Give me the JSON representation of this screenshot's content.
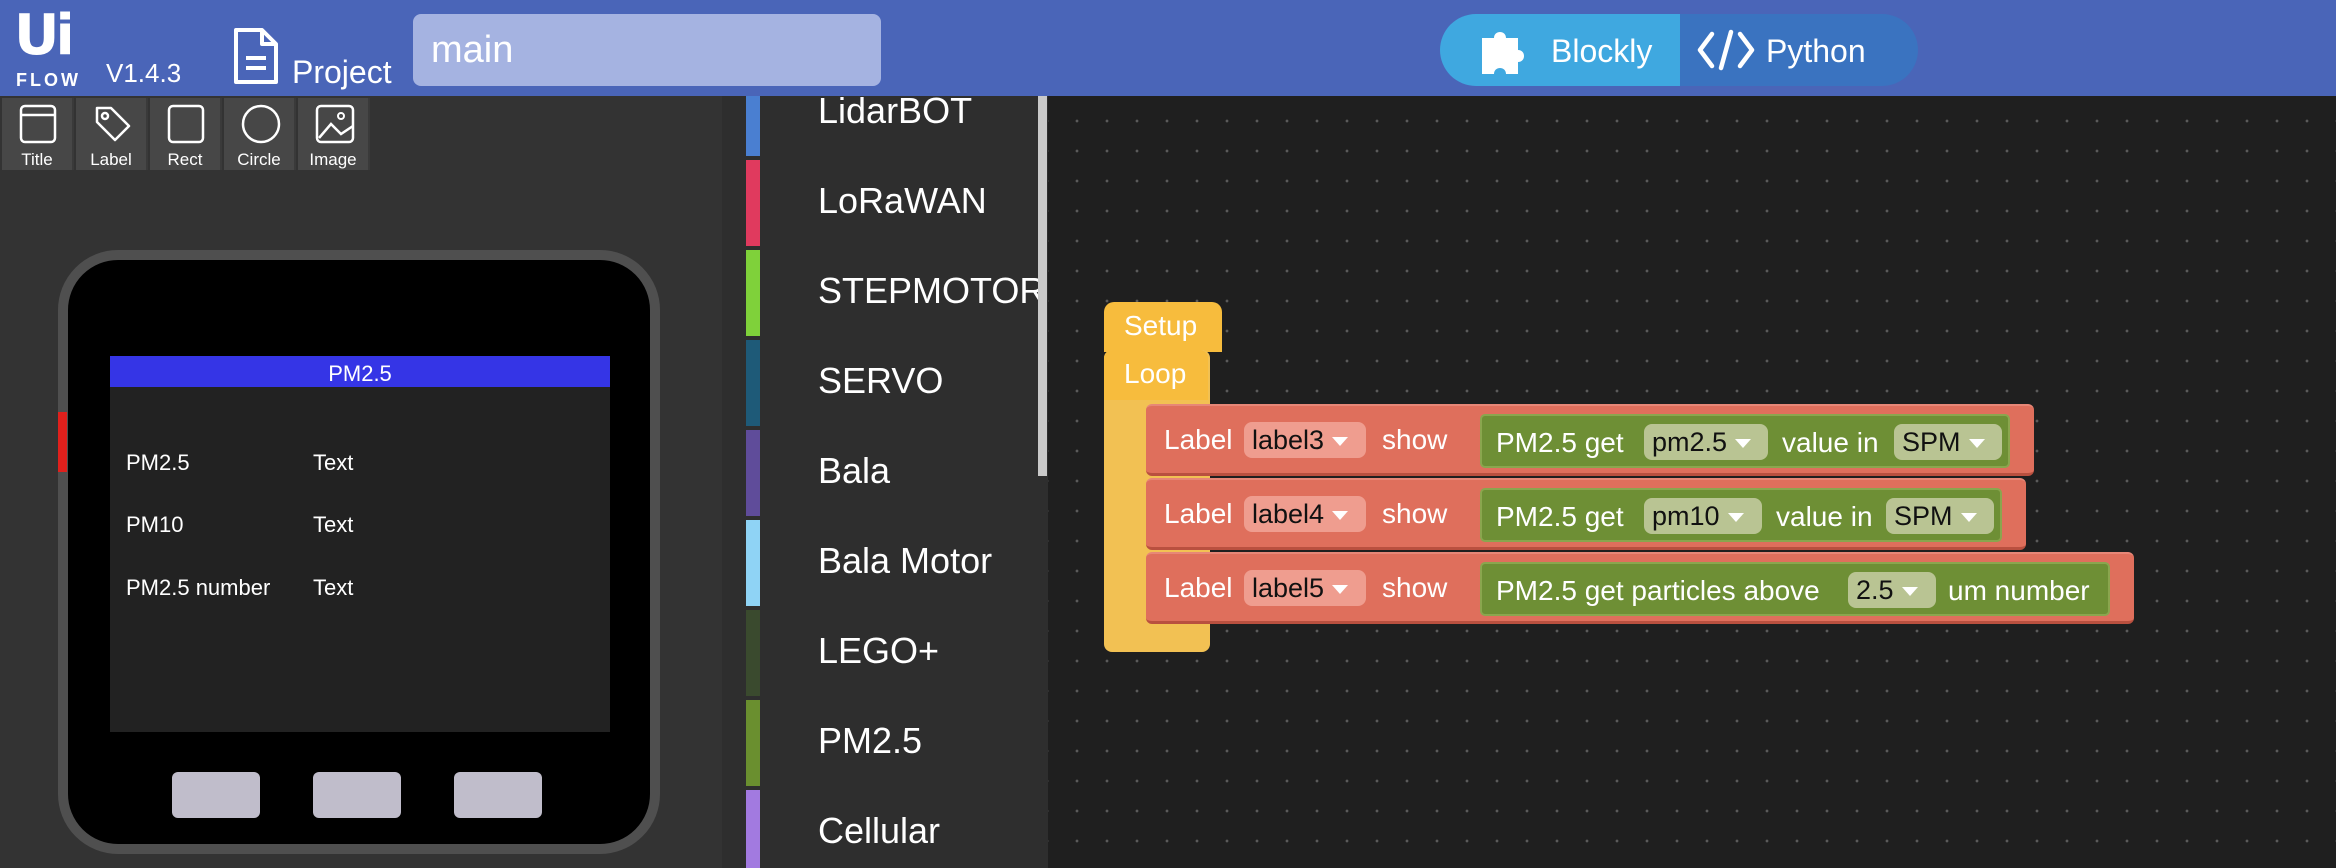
{
  "header": {
    "logo_ui": "Ui",
    "logo_flow": "FLOW",
    "version": "V1.4.3",
    "project_label": "Project",
    "filename": "main",
    "mode_blockly": "Blockly",
    "mode_python": "Python",
    "colors": {
      "bar": "#4a65b8",
      "blockly": "#3fa8e0",
      "python": "#3a73c0"
    }
  },
  "widgets": [
    {
      "label": "Title",
      "icon": "title-icon"
    },
    {
      "label": "Label",
      "icon": "tag-icon"
    },
    {
      "label": "Rect",
      "icon": "rect-icon"
    },
    {
      "label": "Circle",
      "icon": "circle-icon"
    },
    {
      "label": "Image",
      "icon": "image-icon"
    }
  ],
  "screen": {
    "title": "PM2.5",
    "rows": [
      {
        "label": "PM2.5",
        "value": "Text"
      },
      {
        "label": "PM10",
        "value": "Text"
      },
      {
        "label": "PM2.5 number",
        "value": "Text"
      }
    ]
  },
  "categories": [
    {
      "name": "LidarBOT",
      "color": "#4a7fd1"
    },
    {
      "name": "LoRaWAN",
      "color": "#e03a5e"
    },
    {
      "name": "STEPMOTOR",
      "color": "#7fd13a"
    },
    {
      "name": "SERVO",
      "color": "#1e5a78"
    },
    {
      "name": "Bala",
      "color": "#5f4c9a"
    },
    {
      "name": "Bala Motor",
      "color": "#8fd3f5"
    },
    {
      "name": "LEGO+",
      "color": "#3a4a2e"
    },
    {
      "name": "PM2.5",
      "color": "#6a8f2f"
    },
    {
      "name": "Cellular",
      "color": "#a27ae0"
    }
  ],
  "workspace": {
    "setup": "Setup",
    "loop": "Loop",
    "blocks": [
      {
        "prefix": "Label",
        "label": "label3",
        "show": "show",
        "getter": "PM2.5 get",
        "param": "pm2.5",
        "mid": "value in",
        "unit": "SPM",
        "suffix": ""
      },
      {
        "prefix": "Label",
        "label": "label4",
        "show": "show",
        "getter": "PM2.5 get",
        "param": "pm10",
        "mid": "value in",
        "unit": "SPM",
        "suffix": ""
      },
      {
        "prefix": "Label",
        "label": "label5",
        "show": "show",
        "getter": "PM2.5 get particles above",
        "param": "2.5",
        "mid": "",
        "unit": "",
        "suffix": "um number"
      }
    ]
  }
}
